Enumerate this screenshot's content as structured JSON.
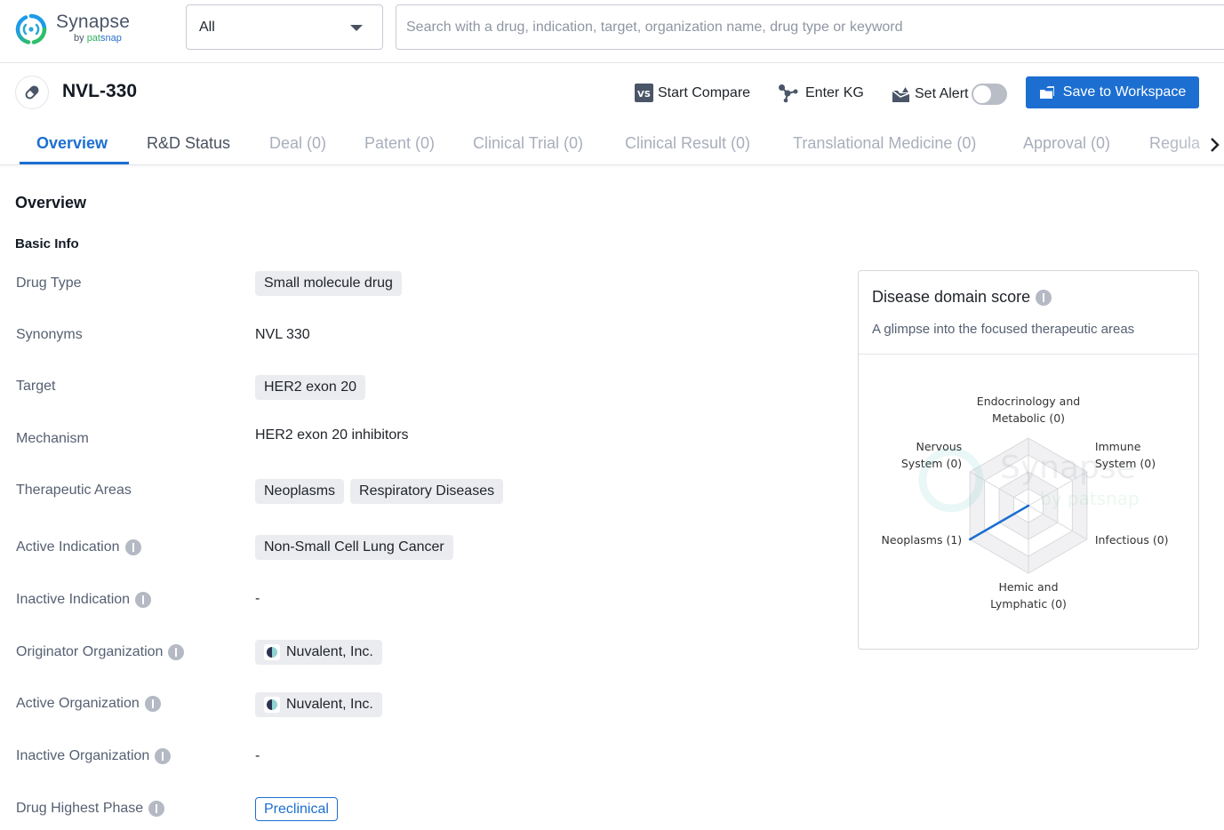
{
  "app": {
    "name": "Synapse",
    "by_prefix": "by",
    "by_brand_1": "pat",
    "by_brand_2": "snap"
  },
  "search": {
    "scope_selected": "All",
    "placeholder": "Search with a drug, indication, target, organization name, drug type or keyword",
    "value": ""
  },
  "drug": {
    "title": "NVL-330",
    "icon": "pill-icon"
  },
  "actions": {
    "compare_label": "Start Compare",
    "kg_label": "Enter KG",
    "alert_label": "Set Alert",
    "alert_enabled": false,
    "save_label": "Save to Workspace"
  },
  "tabs": [
    {
      "label": "Overview",
      "state": "active"
    },
    {
      "label": "R&D Status",
      "state": "enabled"
    },
    {
      "label": "Deal (0)",
      "state": "disabled"
    },
    {
      "label": "Patent (0)",
      "state": "disabled"
    },
    {
      "label": "Clinical Trial (0)",
      "state": "disabled"
    },
    {
      "label": "Clinical Result (0)",
      "state": "disabled"
    },
    {
      "label": "Translational Medicine (0)",
      "state": "disabled"
    },
    {
      "label": "Approval (0)",
      "state": "disabled"
    },
    {
      "label": "Regula",
      "state": "disabled"
    }
  ],
  "overview": {
    "heading": "Overview",
    "subheading": "Basic Info",
    "rows": {
      "drug_type": {
        "label": "Drug Type",
        "chips": [
          "Small molecule drug"
        ]
      },
      "synonyms": {
        "label": "Synonyms",
        "text": "NVL 330"
      },
      "target": {
        "label": "Target",
        "chips": [
          "HER2 exon 20"
        ]
      },
      "mechanism": {
        "label": "Mechanism",
        "text": "HER2 exon 20 inhibitors"
      },
      "therapeutic_areas": {
        "label": "Therapeutic Areas",
        "chips": [
          "Neoplasms",
          "Respiratory Diseases"
        ]
      },
      "active_indication": {
        "label": "Active Indication",
        "chips": [
          "Non-Small Cell Lung Cancer"
        ]
      },
      "inactive_indication": {
        "label": "Inactive Indication",
        "text": "-"
      },
      "originator_org": {
        "label": "Originator Organization",
        "org": "Nuvalent, Inc."
      },
      "active_org": {
        "label": "Active Organization",
        "org": "Nuvalent, Inc."
      },
      "inactive_org": {
        "label": "Inactive Organization",
        "text": "-"
      },
      "highest_phase": {
        "label": "Drug Highest Phase",
        "phase": "Preclinical"
      }
    }
  },
  "disease_card": {
    "title": "Disease domain score",
    "subtitle": "A glimpse into the focused therapeutic areas"
  },
  "colors": {
    "accent": "#1c6fd1",
    "chip_bg": "#ebecef",
    "label": "#566072",
    "disabled_tab": "#a8aebb"
  },
  "chart_data": {
    "type": "radar",
    "title": "Disease domain score",
    "axes": [
      {
        "name": "Endocrinology and Metabolic",
        "label_lines": [
          "Endocrinology and",
          "Metabolic (0)"
        ],
        "value": 0
      },
      {
        "name": "Immune System",
        "label_lines": [
          "Immune",
          "System (0)"
        ],
        "value": 0
      },
      {
        "name": "Infectious",
        "label_lines": [
          "Infectious (0)"
        ],
        "value": 0
      },
      {
        "name": "Hemic and Lymphatic",
        "label_lines": [
          "Hemic and",
          "Lymphatic (0)"
        ],
        "value": 0
      },
      {
        "name": "Neoplasms",
        "label_lines": [
          "Neoplasms (1)"
        ],
        "value": 1
      },
      {
        "name": "Nervous System",
        "label_lines": [
          "Nervous",
          "System (0)"
        ],
        "value": 0
      }
    ],
    "max": 1,
    "rings": 4,
    "series_color": "#1c6fd1"
  }
}
